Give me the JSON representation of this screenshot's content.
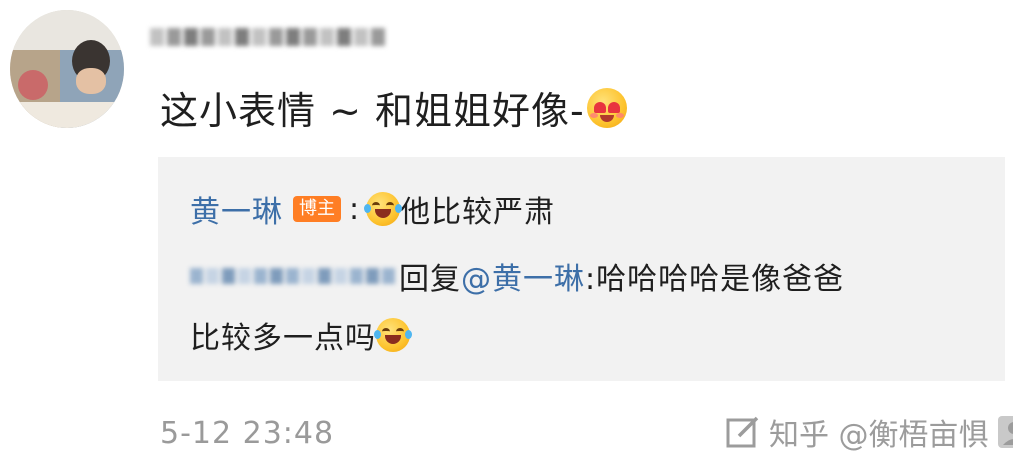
{
  "comment": {
    "text": "这小表情 ~ 和姐姐好像-",
    "emoji": "heart-eyes-emoji",
    "timestamp": "5-12 23:48"
  },
  "reply": {
    "line1": {
      "name": "黄一琳",
      "badge": "博主",
      "colon": ":",
      "emoji": "crying-emoji",
      "text": "他比较严肃"
    },
    "line2": {
      "reply_word": "回复",
      "mention": "@黄一琳",
      "text": ":哈哈哈哈是像爸爸"
    },
    "line3": {
      "text": "比较多一点吗",
      "emoji": "laughing-tears-emoji"
    }
  },
  "watermark": {
    "text": "知乎 @衡梧亩惧"
  },
  "colors": {
    "link": "#3d6fa8",
    "badge": "#ff7e24",
    "reply_bg": "#f2f2f2",
    "timestamp": "#9a9a9a"
  }
}
